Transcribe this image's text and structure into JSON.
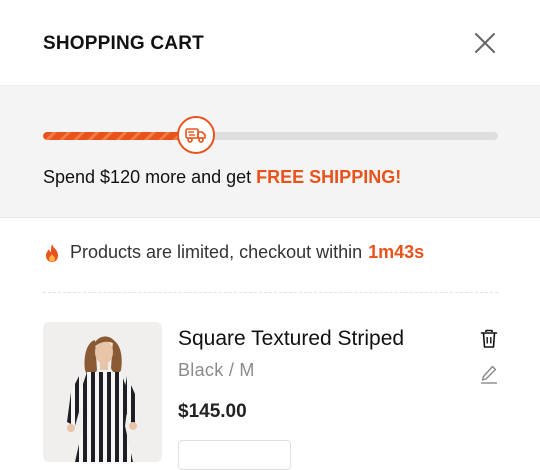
{
  "header": {
    "title": "SHOPPING CART",
    "close_icon": "close-icon"
  },
  "shipping": {
    "progress_percent": 33,
    "icon": "delivery-truck-icon",
    "text_prefix": "Spend $120 more and get ",
    "text_highlight": "FREE SHIPPING!",
    "accent_color": "#e8531c"
  },
  "timer": {
    "icon": "fire-icon",
    "text": "Products are limited, checkout within",
    "time": "1m43s"
  },
  "cart": {
    "items": [
      {
        "name": "Square Textured Striped",
        "variant": "Black / M",
        "price": "$145.00",
        "image": "striped-shirt-dress-product-image",
        "remove_icon": "trash-icon",
        "edit_icon": "edit-pencil-icon"
      }
    ]
  }
}
